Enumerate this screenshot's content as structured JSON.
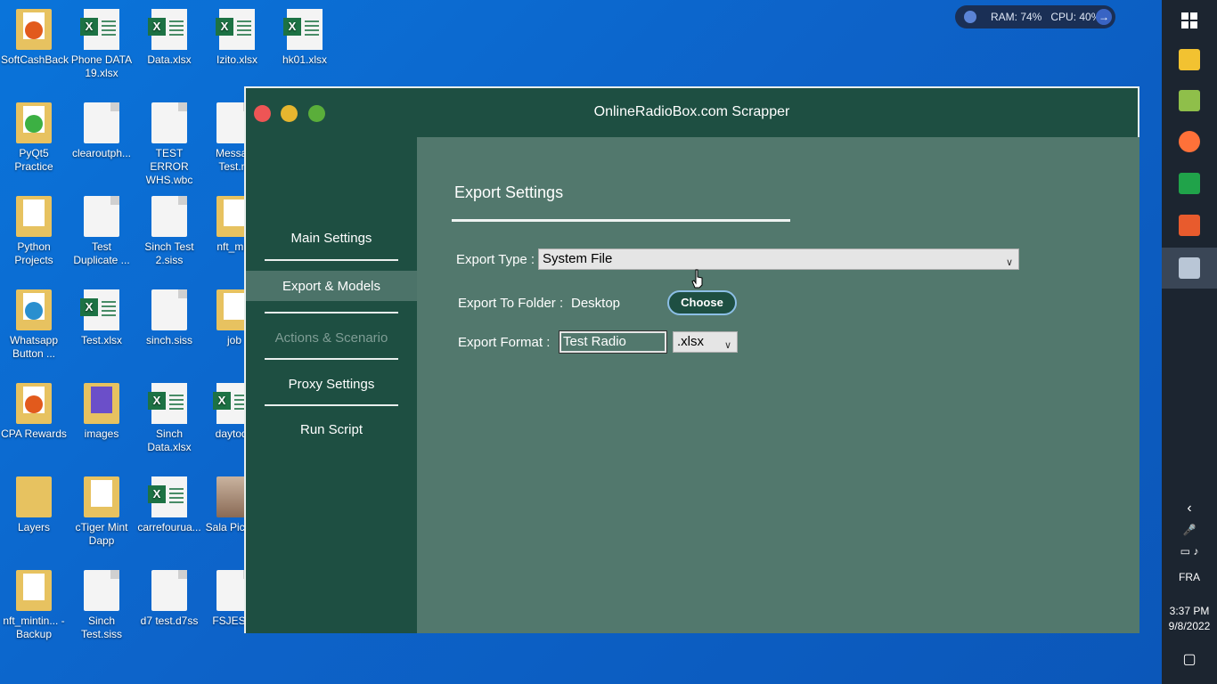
{
  "desktop": {
    "icons": [
      {
        "label": "SoftCashBack"
      },
      {
        "label": "Phone DATA 19.xlsx"
      },
      {
        "label": "Data.xlsx"
      },
      {
        "label": "Izito.xlsx"
      },
      {
        "label": "hk01.xlsx"
      },
      {
        "label": "PyQt5 Practice"
      },
      {
        "label": "clearoutph..."
      },
      {
        "label": "TEST ERROR WHS.wbc"
      },
      {
        "label": "Messag Test.m"
      },
      {
        "label": "Python Projects"
      },
      {
        "label": "Test Duplicate ..."
      },
      {
        "label": "Sinch Test 2.siss"
      },
      {
        "label": "nft_min"
      },
      {
        "label": "Whatsapp Button ..."
      },
      {
        "label": "Test.xlsx"
      },
      {
        "label": "sinch.siss"
      },
      {
        "label": "job"
      },
      {
        "label": "CPA Rewards"
      },
      {
        "label": "images"
      },
      {
        "label": "Sinch Data.xlsx"
      },
      {
        "label": "daytoda"
      },
      {
        "label": "Layers"
      },
      {
        "label": "cTiger Mint Dapp"
      },
      {
        "label": "carrefourua..."
      },
      {
        "label": "Sala Picture"
      },
      {
        "label": "nft_mintin... - Backup"
      },
      {
        "label": "Sinch Test.siss"
      },
      {
        "label": "d7 test.d7ss"
      },
      {
        "label": "FSJES-S"
      }
    ]
  },
  "resource_monitor": {
    "ram": "RAM: 74%",
    "cpu": "CPU: 40%"
  },
  "window": {
    "title": "OnlineRadioBox.com Scrapper",
    "sidebar": {
      "items": [
        {
          "label": "Main Settings"
        },
        {
          "label": "Export & Models"
        },
        {
          "label": "Actions & Scenario"
        },
        {
          "label": "Proxy Settings"
        },
        {
          "label": "Run Script"
        }
      ]
    },
    "export": {
      "section_title": "Export Settings",
      "export_type_label": "Export Type :",
      "export_type_value": "System File",
      "export_folder_label": "Export To Folder :",
      "export_folder_value": "Desktop",
      "choose_label": "Choose",
      "export_format_label": "Export Format :",
      "export_format_value": "Test Radio",
      "extension_value": ".xlsx"
    }
  },
  "taskbar": {
    "language": "FRA",
    "time": "3:37 PM",
    "date": "9/8/2022"
  },
  "colors": {
    "sidebar_bg": "#1e4f42",
    "content_bg": "#52786d",
    "active_nav": "#4c7369",
    "close": "#ee5555",
    "minimize": "#e6b62f",
    "maximize": "#5aae3a"
  }
}
